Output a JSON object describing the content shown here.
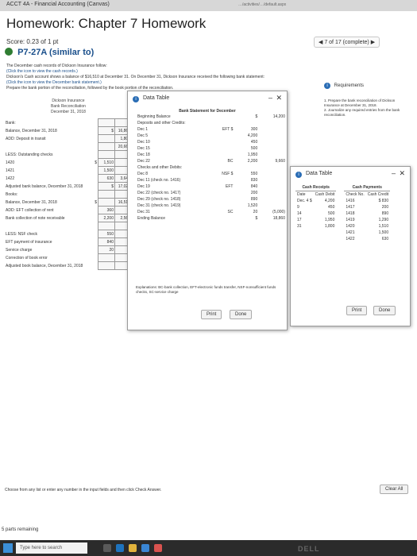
{
  "browser": {
    "tab_title": "ACCT 4A - Financial Accounting (Canvas)",
    "url": "…/activities/…/default.aspx"
  },
  "header": {
    "title": "Homework: Chapter 7 Homework",
    "score": "Score: 0.23 of 1 pt",
    "nav": "7 of 17 (complete)"
  },
  "problem": {
    "id": "P7-27A (similar to)",
    "lines": [
      "The December cash records of Dickson Insurance follow:",
      "(Click the icon to view the cash records.)",
      "Dickson's Cash account shows a balance of $16,510 at December 31. On December 31, Dickson Insurance received the following bank statement:",
      "(Click the icon to view the December bank statement.)",
      "Prepare the bank portion of the reconciliation, followed by the book portion of the reconciliation."
    ]
  },
  "requirements": {
    "title": "Requirements",
    "items": [
      "1. Prepare the bank reconciliation of Dickson Insurance at December 31, 2018.",
      "2. Journalize any required entries from the bank reconciliation."
    ]
  },
  "reconciliation": {
    "company": "Dickson Insurance",
    "title": "Bank Reconciliation",
    "date": "December 31, 2018",
    "rows": [
      {
        "label": "Bank:",
        "a": "",
        "b": "",
        "c": ""
      },
      {
        "label": "Balance, December 31, 2018",
        "a": "",
        "b": "$",
        "c": "16,860"
      },
      {
        "label": "ADD:   Deposit in transit",
        "a": "",
        "b": "",
        "c": "1,800"
      },
      {
        "label": "",
        "a": "",
        "b": "",
        "c": "20,660"
      },
      {
        "label": "LESS:   Outstanding checks",
        "a": "",
        "b": "",
        "c": ""
      },
      {
        "label": "1420",
        "a": "$",
        "b": "1,510",
        "c": ""
      },
      {
        "label": "1421",
        "a": "",
        "b": "1,500",
        "c": ""
      },
      {
        "label": "1422",
        "a": "",
        "b": "630",
        "c": "3,640"
      },
      {
        "label": "Adjusted bank balance, December 31, 2018",
        "a": "",
        "b": "$",
        "c": "17,020"
      },
      {
        "label": "Books:",
        "a": "",
        "b": "",
        "c": ""
      },
      {
        "label": "Balance, December 31, 2018",
        "a": "$",
        "b": "",
        "c": "16,510"
      },
      {
        "label": "ADD:   EFT collection of rent",
        "a": "",
        "b": "360",
        "c": ""
      },
      {
        "label": "Bank collection of note receivable",
        "a": "",
        "b": "2,200",
        "c": "2,560"
      },
      {
        "label": "",
        "a": "",
        "b": "",
        "c": ""
      },
      {
        "label": "LESS:   NSF check",
        "a": "",
        "b": "550",
        "c": ""
      },
      {
        "label": "EFT payment of insurance",
        "a": "",
        "b": "840",
        "c": ""
      },
      {
        "label": "Service charge",
        "a": "",
        "b": "20",
        "c": ""
      },
      {
        "label": "Correction of book error",
        "a": "",
        "b": "",
        "c": ""
      },
      {
        "label": "Adjusted book balance, December 31, 2018",
        "a": "",
        "b": "",
        "c": ""
      }
    ]
  },
  "bank_statement": {
    "popup_title": "Data Table",
    "heading": "Bank Statement for December",
    "rows": [
      {
        "c1": "Beginning Balance",
        "c2": "",
        "c3": "$",
        "c4": "14,200"
      },
      {
        "c1": "Deposits and other Credits:",
        "c2": "",
        "c3": "",
        "c4": ""
      },
      {
        "c1": "Dec   1",
        "c2": "EFT $",
        "c3": "300",
        "c4": ""
      },
      {
        "c1": "Dec   5",
        "c2": "",
        "c3": "4,200",
        "c4": ""
      },
      {
        "c1": "Dec   10",
        "c2": "",
        "c3": "450",
        "c4": ""
      },
      {
        "c1": "Dec   15",
        "c2": "",
        "c3": "500",
        "c4": ""
      },
      {
        "c1": "Dec   18",
        "c2": "",
        "c3": "1,950",
        "c4": ""
      },
      {
        "c1": "Dec   22",
        "c2": "BC",
        "c3": "2,200",
        "c4": "9,660"
      },
      {
        "c1": "Checks and other Debits:",
        "c2": "",
        "c3": "",
        "c4": ""
      },
      {
        "c1": "Dec   8",
        "c2": "NSF $",
        "c3": "550",
        "c4": ""
      },
      {
        "c1": "Dec   11 (check no. 1416)",
        "c2": "",
        "c3": "830",
        "c4": ""
      },
      {
        "c1": "Dec   19",
        "c2": "EFT",
        "c3": "840",
        "c4": ""
      },
      {
        "c1": "Dec   22 (check no. 1417)",
        "c2": "",
        "c3": "200",
        "c4": ""
      },
      {
        "c1": "Dec   29 (check no. 1418)",
        "c2": "",
        "c3": "890",
        "c4": ""
      },
      {
        "c1": "Dec   31 (check no. 1419)",
        "c2": "",
        "c3": "1,520",
        "c4": ""
      },
      {
        "c1": "Dec   31",
        "c2": "SC",
        "c3": "20",
        "c4": "(5,000)"
      },
      {
        "c1": "Ending Balance",
        "c2": "",
        "c3": "$",
        "c4": "18,860"
      }
    ],
    "explanation": "Explanations: BC-bank collection, EFT-electronic funds transfer, NSF-nonsufficient funds checks, SC-service charge",
    "print": "Print",
    "done": "Done"
  },
  "cash_records": {
    "popup_title": "Data Table",
    "receipts_heading": "Cash Receipts",
    "payments_heading": "Cash Payments",
    "receipts_cols": [
      "Date",
      "Cash Debit"
    ],
    "payments_cols": [
      "Check No.",
      "Cash Credit"
    ],
    "receipts": [
      [
        "Dec. 4 $",
        "4,200"
      ],
      [
        "9",
        "450"
      ],
      [
        "14",
        "500"
      ],
      [
        "17",
        "1,950"
      ],
      [
        "31",
        "1,800"
      ],
      [
        "",
        ""
      ],
      [
        "",
        ""
      ]
    ],
    "payments": [
      [
        "1416",
        "$ 830"
      ],
      [
        "1417",
        "200"
      ],
      [
        "1418",
        "890"
      ],
      [
        "1419",
        "1,290"
      ],
      [
        "1420",
        "1,510"
      ],
      [
        "1421",
        "1,500"
      ],
      [
        "1422",
        "630"
      ]
    ],
    "print": "Print",
    "done": "Done"
  },
  "footer": {
    "instruction": "Choose from any list or enter any number in the input fields and then click Check Answer.",
    "clear_all": "Clear All",
    "remaining": "5 parts remaining"
  },
  "taskbar": {
    "search": "Type here to search",
    "time": "",
    "brand": "DELL"
  }
}
